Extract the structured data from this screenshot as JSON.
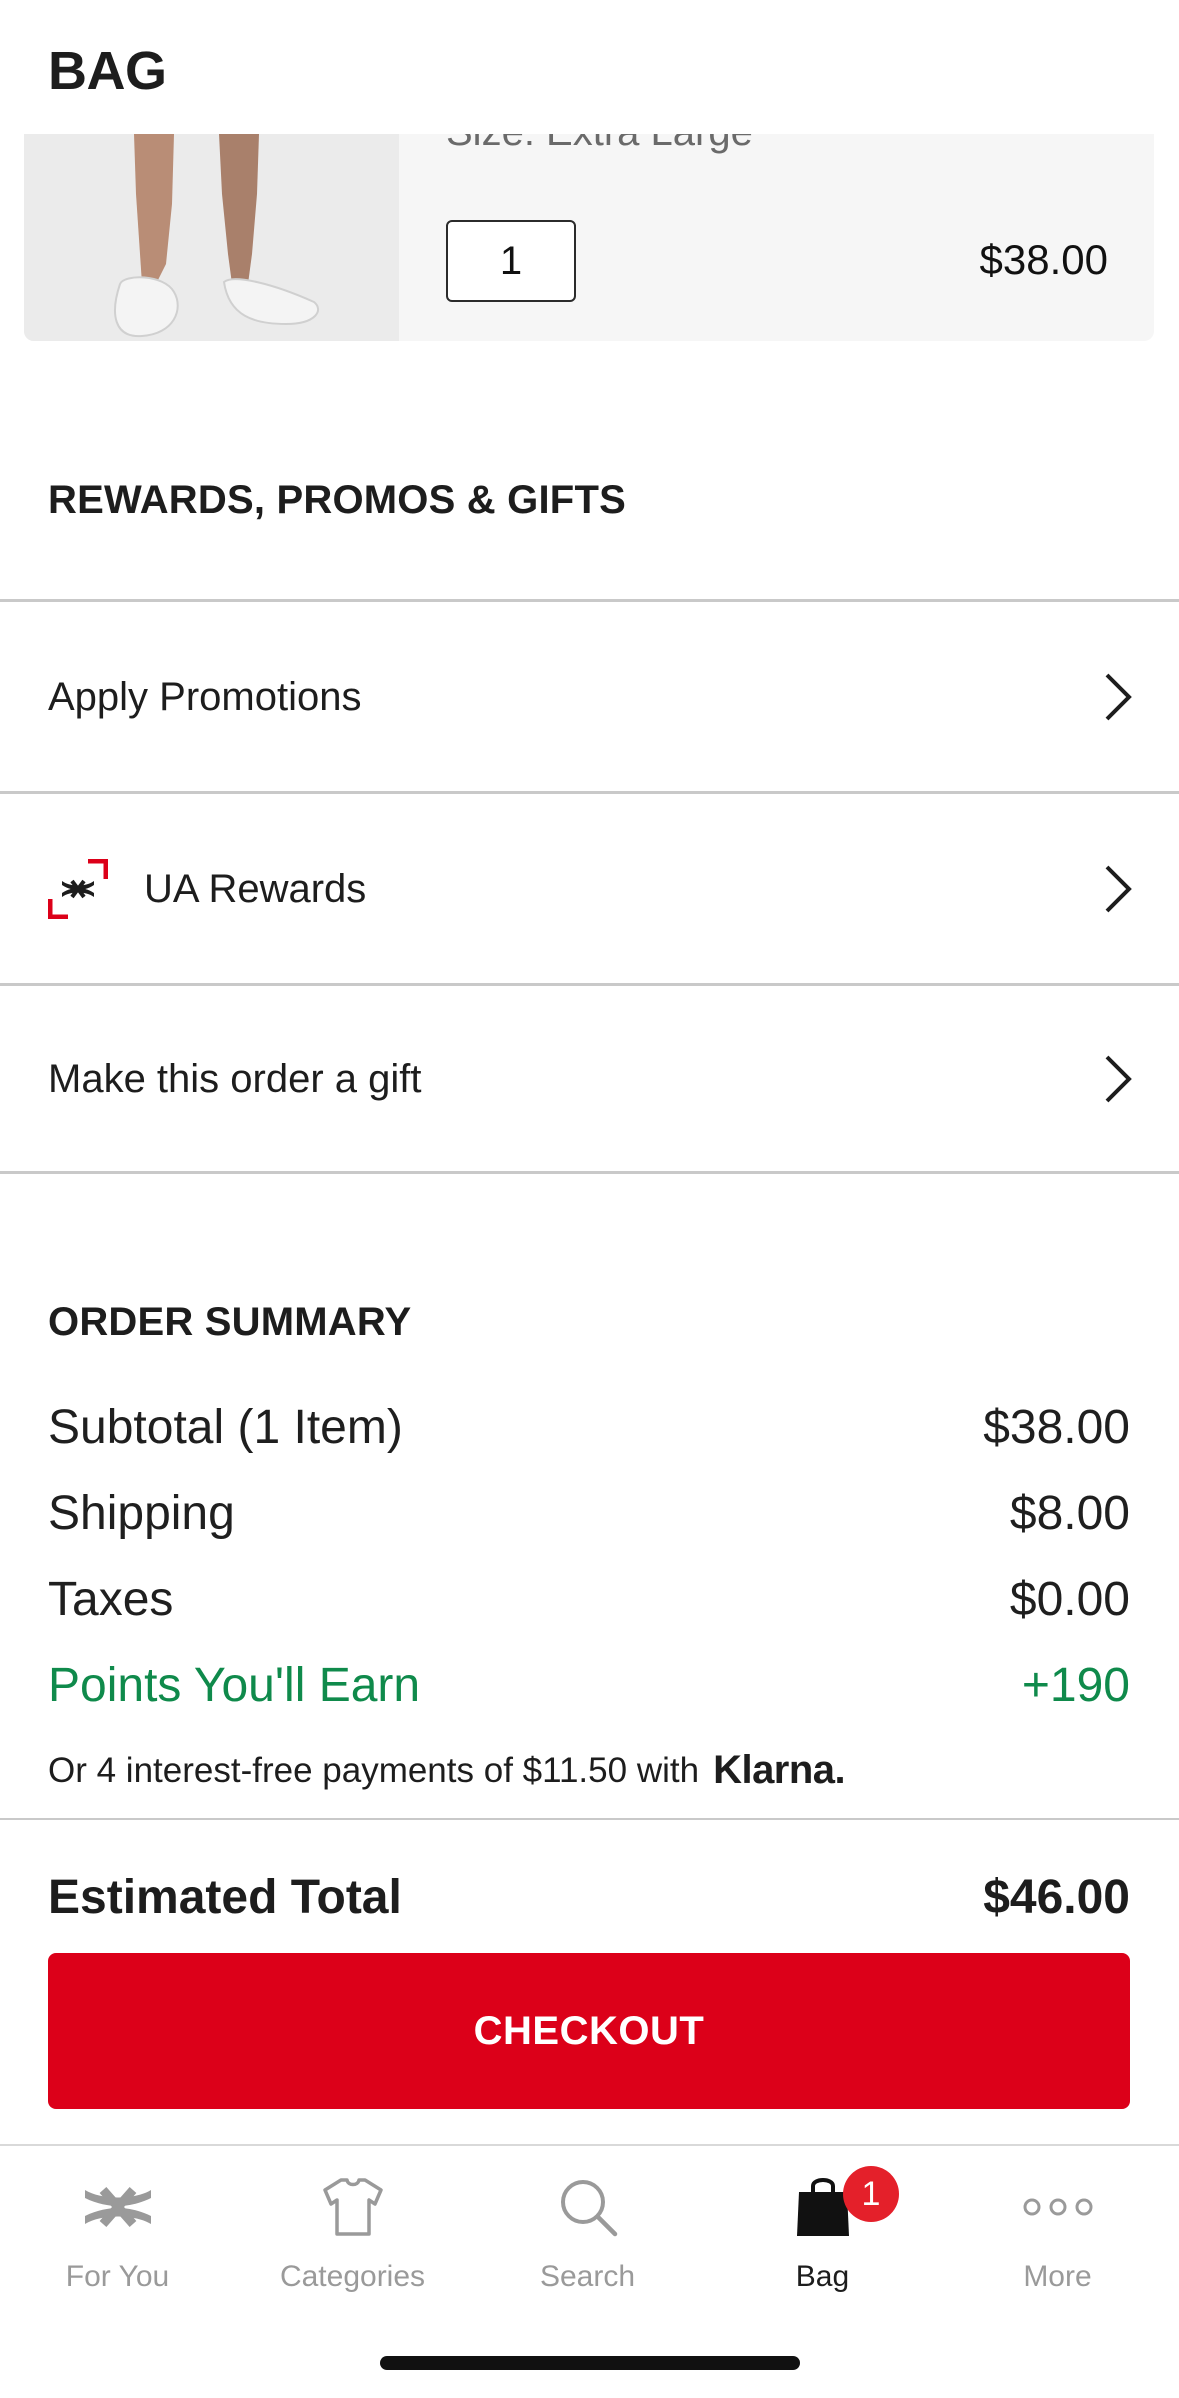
{
  "header": {
    "title": "BAG"
  },
  "product": {
    "size_text": "Size: Extra Large",
    "quantity": "1",
    "price": "$38.00"
  },
  "rewards_section": {
    "heading": "REWARDS, PROMOS & GIFTS",
    "rows": [
      {
        "label": "Apply Promotions"
      },
      {
        "label": "UA Rewards"
      },
      {
        "label": "Make this order a gift"
      }
    ]
  },
  "summary": {
    "heading": "ORDER SUMMARY",
    "lines": [
      {
        "label": "Subtotal (1 Item)",
        "value": "$38.00"
      },
      {
        "label": "Shipping",
        "value": "$8.00"
      },
      {
        "label": "Taxes",
        "value": "$0.00"
      },
      {
        "label": "Points You'll Earn",
        "value": "+190"
      }
    ],
    "klarna_text": "Or 4 interest-free payments of $11.50 with",
    "klarna_brand": "Klarna.",
    "total_label": "Estimated Total",
    "total_value": "$46.00",
    "checkout_label": "CHECKOUT"
  },
  "tabbar": {
    "tabs": [
      {
        "label": "For You",
        "icon": "under-armour-logo-icon"
      },
      {
        "label": "Categories",
        "icon": "shirt-icon"
      },
      {
        "label": "Search",
        "icon": "search-icon"
      },
      {
        "label": "Bag",
        "icon": "bag-icon",
        "active": true,
        "badge": "1"
      },
      {
        "label": "More",
        "icon": "more-dots-icon"
      }
    ]
  },
  "colors": {
    "brand_red": "#dc0019",
    "points_green": "#0f8a4b",
    "badge_red": "#e4202a"
  }
}
